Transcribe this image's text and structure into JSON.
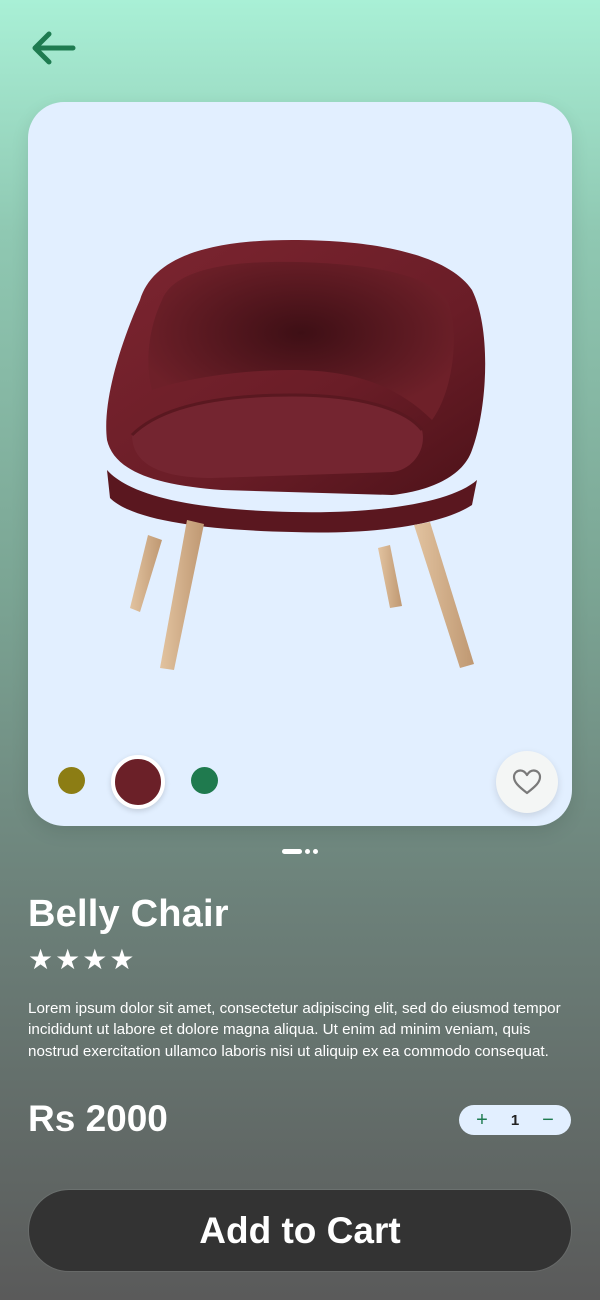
{
  "colors": {
    "accent": "#1e7b50",
    "card_bg": "#e2efff",
    "button_bg": "#333333"
  },
  "nav": {
    "back_icon": "arrow-left-icon"
  },
  "product": {
    "image": "maroon-armchair-with-wooden-legs",
    "name": "Belly Chair",
    "rating_stars": 4,
    "description": "Lorem ipsum dolor sit amet, consectetur adipiscing elit, sed do eiusmod tempor incididunt ut labore et dolore magna aliqua. Ut enim ad minim veniam, quis nostrud exercitation ullamco laboris nisi ut aliquip ex ea commodo consequat.",
    "price": "Rs 2000"
  },
  "color_options": [
    {
      "hex": "#8c7d14",
      "selected": false
    },
    {
      "hex": "#6b2028",
      "selected": true
    },
    {
      "hex": "#1f7a4e",
      "selected": false
    }
  ],
  "favorite_icon": "heart-outline-icon",
  "pager": {
    "pages": 3,
    "active": 0
  },
  "quantity": {
    "value": "1",
    "plus_label": "+",
    "minus_label": "−"
  },
  "cta": {
    "label": "Add to Cart"
  }
}
